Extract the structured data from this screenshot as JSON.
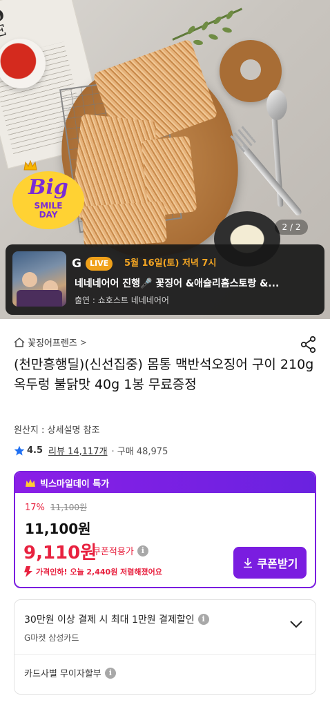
{
  "hero": {
    "newspaper_text": "TO\nSE",
    "badge": {
      "big": "Big",
      "line1": "SMILE",
      "line2": "DAY"
    },
    "page_indicator": "2 / 2"
  },
  "live": {
    "brand": "G",
    "pill": "LIVE",
    "date": "5월 16일(토) 저녁 7시",
    "title": "네네네어어 진행🎤 꽃징어 &애슐리홈스토랑 &...",
    "host": "출연 : 쇼호스트 네네네어어"
  },
  "seller": {
    "name": "꽃징어프렌즈",
    "chevron": ">"
  },
  "product": {
    "title": "(천만흥행딜)(신선집중) 몸통 맥반석오징어 구이 210g 옥두렁 불닭맛 40g 1봉 무료증정",
    "origin": "원산지 : 상세설명 참조",
    "rating": "4.5",
    "review": "리뷰 14,117개",
    "buys": "· 구매 48,975"
  },
  "deal": {
    "header": "빅스마일데이 특가",
    "discount": "17%",
    "original_price": "11,100원",
    "price": "11,100원",
    "coupon_price": "9,110원",
    "coupon_label": "쿠폰적용가",
    "info": "i",
    "drop_text": "가격인하! 오늘 2,440원 저렴해졌어요",
    "coupon_button": "쿠폰받기"
  },
  "card": {
    "line1": "30만원 이상 결제 시 최대 1만원 결제할인",
    "line2": "G마켓 삼성카드",
    "line3": "카드사별 무이자할부",
    "info": "i"
  },
  "colors": {
    "accent_purple": "#7a1de0",
    "price_red": "#e8213f",
    "live_orange": "#f5a623",
    "badge_yellow": "#ffd233"
  }
}
